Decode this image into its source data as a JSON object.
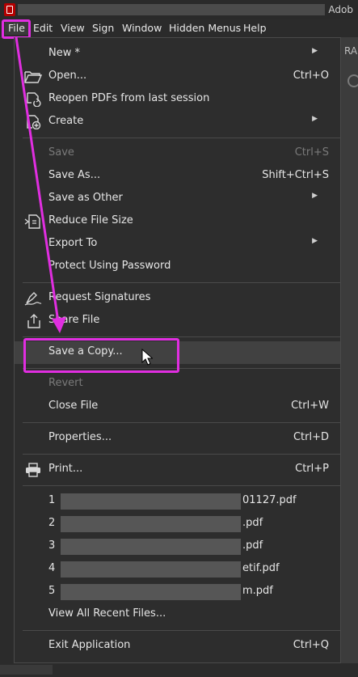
{
  "window": {
    "title": "Adob"
  },
  "menubar": [
    "File",
    "Edit",
    "View",
    "Sign",
    "Window",
    "Hidden Menus",
    "Help"
  ],
  "right_peek_text": "RA",
  "file_menu": {
    "new": {
      "label": "New *"
    },
    "open": {
      "label": "Open...",
      "shortcut": "Ctrl+O"
    },
    "reopen": {
      "label": "Reopen PDFs from last session"
    },
    "create": {
      "label": "Create"
    },
    "save": {
      "label": "Save",
      "shortcut": "Ctrl+S"
    },
    "save_as": {
      "label": "Save As...",
      "shortcut": "Shift+Ctrl+S"
    },
    "save_as_other": {
      "label": "Save as Other"
    },
    "reduce_file_size": {
      "label": "Reduce File Size"
    },
    "export_to": {
      "label": "Export To"
    },
    "protect": {
      "label": "Protect Using Password"
    },
    "request_signatures": {
      "label": "Request Signatures"
    },
    "share_file": {
      "label": "Share File"
    },
    "save_a_copy": {
      "label": "Save a Copy..."
    },
    "revert": {
      "label": "Revert"
    },
    "close_file": {
      "label": "Close File",
      "shortcut": "Ctrl+W"
    },
    "properties": {
      "label": "Properties...",
      "shortcut": "Ctrl+D"
    },
    "print": {
      "label": "Print...",
      "shortcut": "Ctrl+P"
    },
    "recent_files": [
      {
        "index": "1",
        "name": "01127.pdf"
      },
      {
        "index": "2",
        "name": ".pdf"
      },
      {
        "index": "3",
        "name": ".pdf"
      },
      {
        "index": "4",
        "name": "etif.pdf"
      },
      {
        "index": "5",
        "name": "m.pdf"
      }
    ],
    "view_all_recent": {
      "label": "View All Recent Files..."
    },
    "exit": {
      "label": "Exit Application",
      "shortcut": "Ctrl+Q"
    }
  },
  "annotation_color": "#e02ee0",
  "icons": {
    "open": "folder-open-icon",
    "reopen": "reopen-icon",
    "create": "create-pdf-icon",
    "reduce": "reduce-size-icon",
    "request_signatures": "signature-pen-icon",
    "share": "share-icon",
    "print": "printer-icon"
  }
}
